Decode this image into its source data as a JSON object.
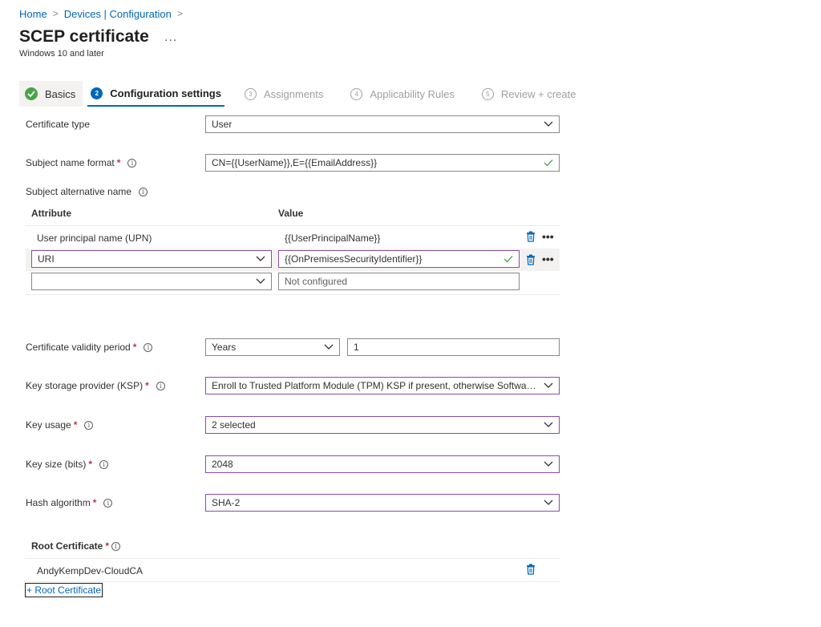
{
  "breadcrumb": {
    "home": "Home",
    "devices": "Devices | Configuration",
    "sep": ">"
  },
  "title": "SCEP certificate",
  "title_more": "...",
  "subtitle": "Windows 10 and later",
  "wizard": {
    "steps": [
      {
        "num": "",
        "label": "Basics",
        "state": "done"
      },
      {
        "num": "2",
        "label": "Configuration settings",
        "state": "active"
      },
      {
        "num": "3",
        "label": "Assignments",
        "state": "pending"
      },
      {
        "num": "4",
        "label": "Applicability Rules",
        "state": "pending"
      },
      {
        "num": "5",
        "label": "Review + create",
        "state": "pending"
      }
    ]
  },
  "form": {
    "certificate_type": {
      "label": "Certificate type",
      "value": "User"
    },
    "subject_name_format": {
      "label": "Subject name format",
      "required": "*",
      "value": "CN={{UserName}},E={{EmailAddress}}"
    },
    "san": {
      "label": "Subject alternative name",
      "col_attribute": "Attribute",
      "col_value": "Value",
      "rows": [
        {
          "attribute": "User principal name (UPN)",
          "value": "{{UserPrincipalName}}"
        },
        {
          "attribute": "URI",
          "value": "{{OnPremisesSecurityIdentifier}}"
        },
        {
          "attribute": "",
          "value_placeholder": "Not configured"
        }
      ],
      "more": "•••"
    },
    "validity": {
      "label": "Certificate validity period",
      "required": "*",
      "unit": "Years",
      "value": "1"
    },
    "ksp": {
      "label": "Key storage provider (KSP)",
      "required": "*",
      "value": "Enroll to Trusted Platform Module (TPM) KSP if present, otherwise Software K..."
    },
    "key_usage": {
      "label": "Key usage",
      "required": "*",
      "value": "2 selected"
    },
    "key_size": {
      "label": "Key size (bits)",
      "required": "*",
      "value": "2048"
    },
    "hash": {
      "label": "Hash algorithm",
      "required": "*",
      "value": "SHA-2"
    },
    "root_cert": {
      "label": "Root Certificate",
      "required": "*",
      "value": "AndyKempDev-CloudCA",
      "add_link": "+ Root Certificate"
    }
  },
  "icons": {
    "info": "i"
  },
  "colors": {
    "accent": "#0067b8",
    "success": "#47a447",
    "required": "#c4314b",
    "focus_border": "#8a4aa8"
  }
}
